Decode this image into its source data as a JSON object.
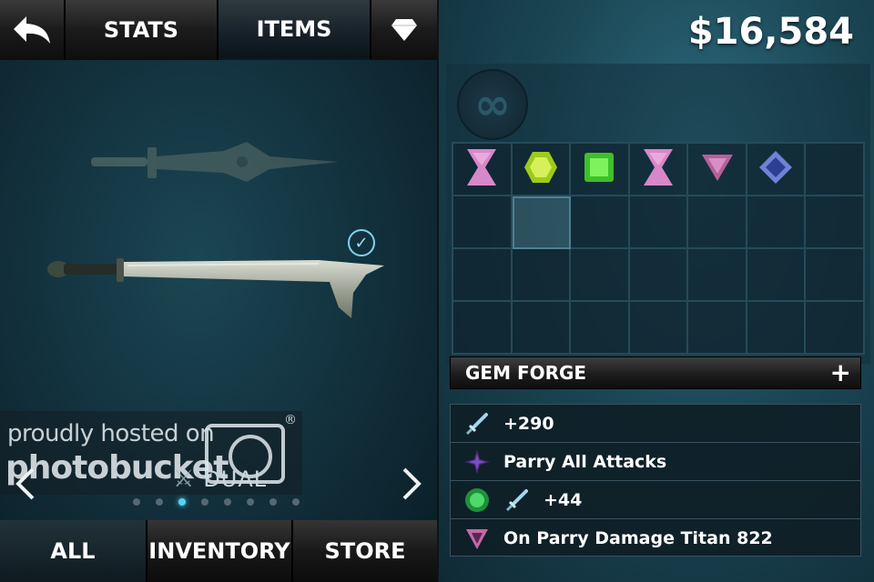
{
  "header": {
    "stats_tab": "STATS",
    "items_tab": "ITEMS"
  },
  "icons": {
    "back": "back-arrow-icon",
    "gem": "diamond-icon",
    "equipped": "check-circle-icon",
    "dual": "crossed-swords-icon",
    "slot": "infinity-icon"
  },
  "currency": "$16,584",
  "watermark": {
    "line1": "proudly hosted on",
    "line2": "photobucket",
    "reg": "®"
  },
  "weapon_type": "DUAL",
  "pager": {
    "count": 8,
    "active_index": 2
  },
  "bottom_tabs": [
    "ALL",
    "INVENTORY",
    "STORE"
  ],
  "gem_grid": {
    "columns": 7,
    "rows": 4,
    "selected_index": 8,
    "gems": [
      {
        "shape": "hourglass",
        "color": "#d887c8"
      },
      {
        "shape": "hexagon",
        "color": "#9ccc1a"
      },
      {
        "shape": "square",
        "color": "#3ec02a"
      },
      {
        "shape": "hourglass",
        "color": "#d887c8"
      },
      {
        "shape": "triangle",
        "color": "#b6609a"
      },
      {
        "shape": "diamond",
        "color": "#6f82d6"
      }
    ]
  },
  "gem_forge": {
    "label": "GEM FORGE",
    "action": "+"
  },
  "stats": [
    {
      "icon": "sword-icon",
      "text": "+290"
    },
    {
      "icon": "purple-star-icon",
      "text": "Parry All Attacks"
    },
    {
      "icon": "green-gem-sword-icon",
      "text": "+44"
    },
    {
      "icon": "pink-triangle-icon",
      "text": "On Parry Damage Titan 822"
    }
  ],
  "colors": {
    "accent": "#58d2f5",
    "panel": "#12313d",
    "grid_line": "#254b59"
  }
}
